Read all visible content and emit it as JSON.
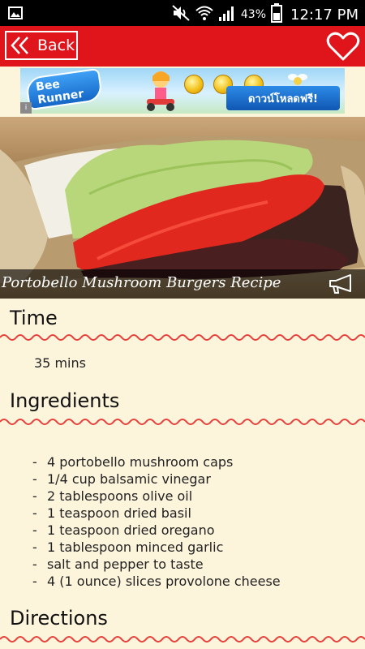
{
  "status_bar": {
    "battery_percent": "43%",
    "time": "12:17 PM"
  },
  "app_bar": {
    "back_label": "Back",
    "favorite_icon": "heart-outline-icon"
  },
  "ad": {
    "logo_line1": "Bee",
    "logo_line2": "Runner",
    "cta_text": "ดาวน์โหลดฟรี!"
  },
  "recipe": {
    "title": "Portobello Mushroom Burgers Recipe",
    "time_heading": "Time",
    "time_value": "35 mins",
    "ingredients_heading": "Ingredients",
    "ingredients": [
      "4 portobello mushroom caps",
      "1/4 cup balsamic vinegar",
      "2 tablespoons olive oil",
      "1 teaspoon dried basil",
      "1 teaspoon dried oregano",
      "1 tablespoon minced garlic",
      "salt and pepper to taste",
      "4 (1 ounce) slices provolone cheese"
    ],
    "directions_heading": "Directions"
  },
  "colors": {
    "app_bar": "#e0141b",
    "background": "#fdf4dc",
    "wave": "#e8403a"
  }
}
